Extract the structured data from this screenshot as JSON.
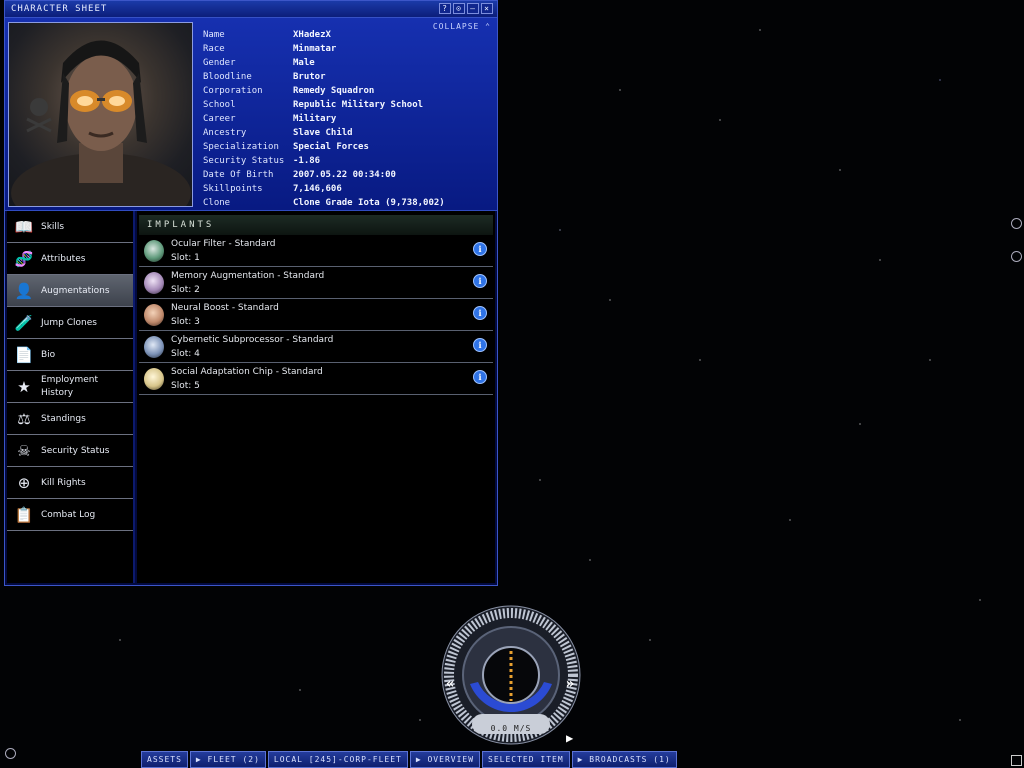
{
  "window": {
    "title": "CHARACTER SHEET",
    "collapse_label": "COLLAPSE",
    "buttons": [
      "?",
      "⊙",
      "–",
      "×"
    ]
  },
  "character": [
    {
      "label": "Name",
      "value": "XHadezX"
    },
    {
      "label": "Race",
      "value": "Minmatar"
    },
    {
      "label": "Gender",
      "value": "Male"
    },
    {
      "label": "Bloodline",
      "value": "Brutor"
    },
    {
      "label": "Corporation",
      "value": "Remedy Squadron"
    },
    {
      "label": "School",
      "value": "Republic Military School"
    },
    {
      "label": "Career",
      "value": "Military"
    },
    {
      "label": "Ancestry",
      "value": "Slave Child"
    },
    {
      "label": "Specialization",
      "value": "Special Forces"
    },
    {
      "label": "Security Status",
      "value": "-1.86"
    },
    {
      "label": "Date Of Birth",
      "value": "2007.05.22 00:34:00"
    },
    {
      "label": "Skillpoints",
      "value": "7,146,606"
    },
    {
      "label": "Clone",
      "value": "Clone Grade Iota (9,738,002)"
    }
  ],
  "nav": [
    {
      "label": "Skills",
      "icon": "book-icon"
    },
    {
      "label": "Attributes",
      "icon": "attributes-icon"
    },
    {
      "label": "Augmentations",
      "icon": "augmentation-icon",
      "active": true
    },
    {
      "label": "Jump Clones",
      "icon": "clone-icon"
    },
    {
      "label": "Bio",
      "icon": "bio-icon"
    },
    {
      "label": "Employment History",
      "icon": "employment-icon"
    },
    {
      "label": "Standings",
      "icon": "standings-icon"
    },
    {
      "label": "Security Status",
      "icon": "skull-icon"
    },
    {
      "label": "Kill Rights",
      "icon": "crosshair-icon"
    },
    {
      "label": "Combat Log",
      "icon": "combat-log-icon"
    }
  ],
  "implants": {
    "header": "IMPLANTS",
    "items": [
      {
        "name": "Ocular Filter - Standard",
        "slot": "Slot: 1",
        "color": "#5f9a7b"
      },
      {
        "name": "Memory Augmentation - Standard",
        "slot": "Slot: 2",
        "color": "#a58ab8"
      },
      {
        "name": "Neural Boost - Standard",
        "slot": "Slot: 3",
        "color": "#c08a6c"
      },
      {
        "name": "Cybernetic Subprocessor - Standard",
        "slot": "Slot: 4",
        "color": "#7d93b8"
      },
      {
        "name": "Social Adaptation Chip - Standard",
        "slot": "Slot: 5",
        "color": "#d7c58a"
      }
    ]
  },
  "hud": {
    "speed": "0.0 M/S"
  },
  "bottom_tabs": [
    "ASSETS",
    "▶ FLEET (2)",
    "LOCAL [245]-CORP-FLEET",
    "▶ OVERVIEW",
    "SELECTED ITEM",
    "▶ BROADCASTS (1)"
  ]
}
